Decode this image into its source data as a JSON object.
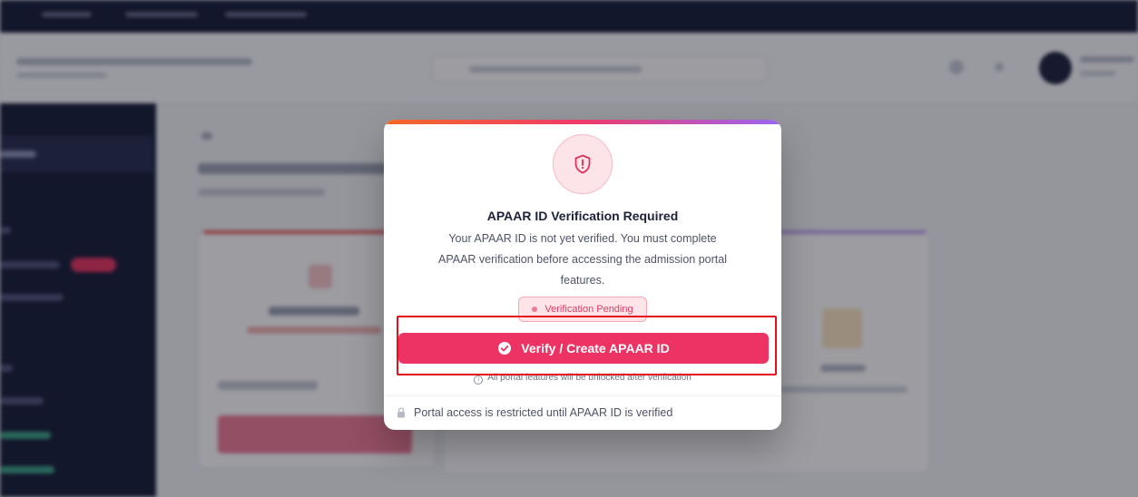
{
  "modal": {
    "title": "APAAR ID Verification Required",
    "description": "Your APAAR ID is not yet verified. You must complete APAAR verification before accessing the admission portal features.",
    "status_badge": "Verification Pending",
    "verify_button_label": "Verify / Create APAAR ID",
    "unlock_note": "All portal features will be unlocked after verification",
    "footer_text": "Portal access is restricted until APAAR ID is verified",
    "icons": {
      "header": "shield-alert-icon",
      "badge": "status-dot",
      "button": "check-circle-icon",
      "note": "info-icon",
      "footer": "lock-icon"
    }
  },
  "colors": {
    "accent_gradient": [
      "#f26a27",
      "#ee3a6a",
      "#9b66f2"
    ],
    "primary_button": "#ec3363",
    "pending_badge_text": "#e23a63",
    "highlight_box": "#e4101c"
  }
}
